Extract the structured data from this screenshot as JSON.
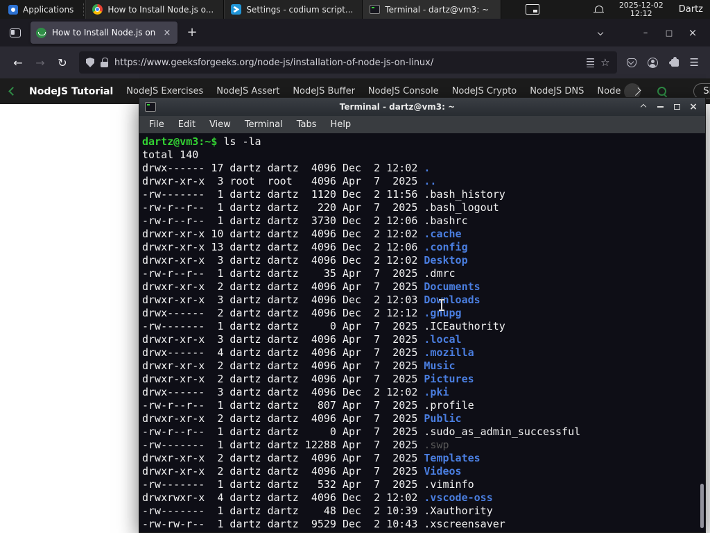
{
  "panel": {
    "applications_label": "Applications",
    "tasks": [
      {
        "label": "How to Install Node.js o..."
      },
      {
        "label": "Settings - codium script..."
      },
      {
        "label": "Terminal - dartz@vm3: ~"
      }
    ],
    "clock": {
      "date": "2025-12-02",
      "time": "12:12"
    },
    "user": "Dartz"
  },
  "browser": {
    "tab": {
      "title": "How to Install Node.js on",
      "close": "×"
    },
    "new_tab": "+",
    "window_controls": {
      "minimize": "–",
      "maximize": "□",
      "close": "×"
    },
    "back": "←",
    "forward": "→",
    "reload": "↻",
    "url": "https://www.geeksforgeeks.org/node-js/installation-of-node-js-on-linux/",
    "star": "☆",
    "menu": "☰"
  },
  "page": {
    "brand": "NodeJS Tutorial",
    "links": [
      "NodeJS Exercises",
      "NodeJS Assert",
      "NodeJS Buffer",
      "NodeJS Console",
      "NodeJS Crypto",
      "NodeJS DNS",
      "Node"
    ],
    "sign_in": "Sign In",
    "accent_green": "#2f8d46"
  },
  "terminal": {
    "title": "Terminal - dartz@vm3: ~",
    "menu": [
      "File",
      "Edit",
      "View",
      "Terminal",
      "Tabs",
      "Help"
    ],
    "window_controls": {
      "close": "×"
    },
    "prompt": "dartz@vm3:~$",
    "command": "ls -la",
    "total": "total 140",
    "colors": {
      "background": "#0e0e16",
      "foreground": "#f2f2f2",
      "prompt_green": "#33d133",
      "dir_blue": "#4a7ee0",
      "dim_gray": "#585858"
    },
    "listing": [
      {
        "pre": "drwx------ 17 dartz dartz  4096 Dec  2 12:02 ",
        "name": ".",
        "type": "dir"
      },
      {
        "pre": "drwxr-xr-x  3 root  root   4096 Apr  7  2025 ",
        "name": "..",
        "type": "dir"
      },
      {
        "pre": "-rw-------  1 dartz dartz  1120 Dec  2 11:56 ",
        "name": ".bash_history",
        "type": "file"
      },
      {
        "pre": "-rw-r--r--  1 dartz dartz   220 Apr  7  2025 ",
        "name": ".bash_logout",
        "type": "file"
      },
      {
        "pre": "-rw-r--r--  1 dartz dartz  3730 Dec  2 12:06 ",
        "name": ".bashrc",
        "type": "file"
      },
      {
        "pre": "drwxr-xr-x 10 dartz dartz  4096 Dec  2 12:02 ",
        "name": ".cache",
        "type": "dir"
      },
      {
        "pre": "drwxr-xr-x 13 dartz dartz  4096 Dec  2 12:06 ",
        "name": ".config",
        "type": "dir"
      },
      {
        "pre": "drwxr-xr-x  3 dartz dartz  4096 Dec  2 12:02 ",
        "name": "Desktop",
        "type": "dir"
      },
      {
        "pre": "-rw-r--r--  1 dartz dartz    35 Apr  7  2025 ",
        "name": ".dmrc",
        "type": "file"
      },
      {
        "pre": "drwxr-xr-x  2 dartz dartz  4096 Apr  7  2025 ",
        "name": "Documents",
        "type": "dir"
      },
      {
        "pre": "drwxr-xr-x  3 dartz dartz  4096 Dec  2 12:03 ",
        "name": "Downloads",
        "type": "dir"
      },
      {
        "pre": "drwx------  2 dartz dartz  4096 Dec  2 12:12 ",
        "name": ".gnupg",
        "type": "dir"
      },
      {
        "pre": "-rw-------  1 dartz dartz     0 Apr  7  2025 ",
        "name": ".ICEauthority",
        "type": "file"
      },
      {
        "pre": "drwxr-xr-x  3 dartz dartz  4096 Apr  7  2025 ",
        "name": ".local",
        "type": "dir"
      },
      {
        "pre": "drwx------  4 dartz dartz  4096 Apr  7  2025 ",
        "name": ".mozilla",
        "type": "dir"
      },
      {
        "pre": "drwxr-xr-x  2 dartz dartz  4096 Apr  7  2025 ",
        "name": "Music",
        "type": "dir"
      },
      {
        "pre": "drwxr-xr-x  2 dartz dartz  4096 Apr  7  2025 ",
        "name": "Pictures",
        "type": "dir"
      },
      {
        "pre": "drwx------  3 dartz dartz  4096 Dec  2 12:02 ",
        "name": ".pki",
        "type": "dir"
      },
      {
        "pre": "-rw-r--r--  1 dartz dartz   807 Apr  7  2025 ",
        "name": ".profile",
        "type": "file"
      },
      {
        "pre": "drwxr-xr-x  2 dartz dartz  4096 Apr  7  2025 ",
        "name": "Public",
        "type": "dir"
      },
      {
        "pre": "-rw-r--r--  1 dartz dartz     0 Apr  7  2025 ",
        "name": ".sudo_as_admin_successful",
        "type": "file"
      },
      {
        "pre": "-rw-------  1 dartz dartz 12288 Apr  7  2025 ",
        "name": ".swp",
        "type": "dim"
      },
      {
        "pre": "drwxr-xr-x  2 dartz dartz  4096 Apr  7  2025 ",
        "name": "Templates",
        "type": "dir"
      },
      {
        "pre": "drwxr-xr-x  2 dartz dartz  4096 Apr  7  2025 ",
        "name": "Videos",
        "type": "dir"
      },
      {
        "pre": "-rw-------  1 dartz dartz   532 Apr  7  2025 ",
        "name": ".viminfo",
        "type": "file"
      },
      {
        "pre": "drwxrwxr-x  4 dartz dartz  4096 Dec  2 12:02 ",
        "name": ".vscode-oss",
        "type": "dir"
      },
      {
        "pre": "-rw-------  1 dartz dartz    48 Dec  2 10:39 ",
        "name": ".Xauthority",
        "type": "file"
      },
      {
        "pre": "-rw-rw-r--  1 dartz dartz  9529 Dec  2 10:43 ",
        "name": ".xscreensaver",
        "type": "file"
      }
    ]
  }
}
